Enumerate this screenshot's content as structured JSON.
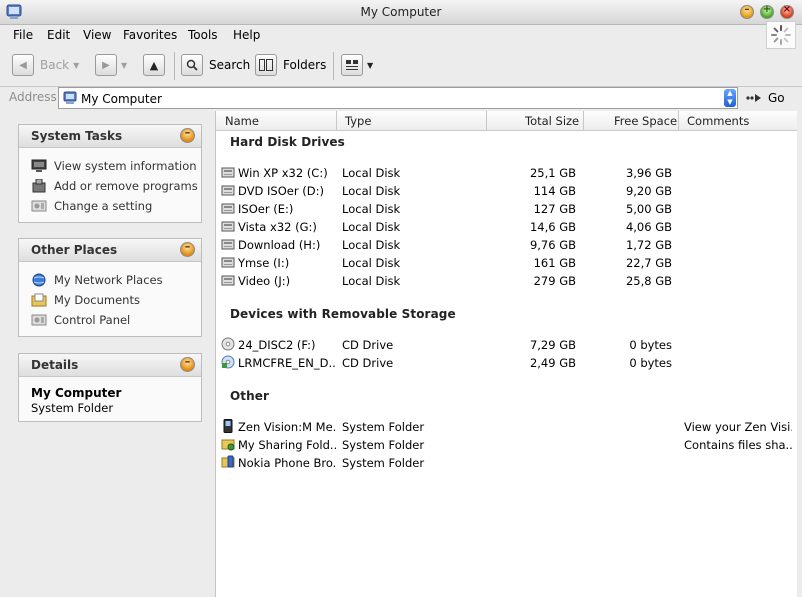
{
  "window": {
    "title": "My Computer"
  },
  "menu": [
    "File",
    "Edit",
    "View",
    "Favorites",
    "Tools",
    "Help"
  ],
  "toolbar": {
    "back": "Back",
    "search": "Search",
    "folders": "Folders"
  },
  "address": {
    "label": "Address",
    "value": "My Computer",
    "go": "Go"
  },
  "panels": {
    "system_tasks": {
      "title": "System Tasks",
      "items": [
        "View system information",
        "Add or remove programs",
        "Change a setting"
      ]
    },
    "other_places": {
      "title": "Other Places",
      "items": [
        "My Network Places",
        "My Documents",
        "Control Panel"
      ]
    },
    "details": {
      "title": "Details",
      "name": "My Computer",
      "sub": "System Folder"
    }
  },
  "columns": {
    "name": "Name",
    "type": "Type",
    "total": "Total Size",
    "free": "Free Space",
    "comments": "Comments"
  },
  "groups": {
    "hdd": {
      "title": "Hard Disk Drives",
      "rows": [
        {
          "name": "Win XP x32 (C:)",
          "type": "Local Disk",
          "total": "25,1 GB",
          "free": "3,96 GB",
          "comment": ""
        },
        {
          "name": "DVD ISOer (D:)",
          "type": "Local Disk",
          "total": "114 GB",
          "free": "9,20 GB",
          "comment": ""
        },
        {
          "name": "ISOer (E:)",
          "type": "Local Disk",
          "total": "127 GB",
          "free": "5,00 GB",
          "comment": ""
        },
        {
          "name": "Vista x32 (G:)",
          "type": "Local Disk",
          "total": "14,6 GB",
          "free": "4,06 GB",
          "comment": ""
        },
        {
          "name": "Download (H:)",
          "type": "Local Disk",
          "total": "9,76 GB",
          "free": "1,72 GB",
          "comment": ""
        },
        {
          "name": "Ymse (I:)",
          "type": "Local Disk",
          "total": "161 GB",
          "free": "22,7 GB",
          "comment": ""
        },
        {
          "name": "Video (J:)",
          "type": "Local Disk",
          "total": "279 GB",
          "free": "25,8 GB",
          "comment": ""
        }
      ]
    },
    "removable": {
      "title": "Devices with Removable Storage",
      "rows": [
        {
          "name": "24_DISC2 (F:)",
          "type": "CD Drive",
          "total": "7,29 GB",
          "free": "0 bytes",
          "comment": ""
        },
        {
          "name": "LRMCFRE_EN_D...",
          "type": "CD Drive",
          "total": "2,49 GB",
          "free": "0 bytes",
          "comment": ""
        }
      ]
    },
    "other": {
      "title": "Other",
      "rows": [
        {
          "name": "Zen Vision:M Me...",
          "type": "System Folder",
          "total": "",
          "free": "",
          "comment": "View your Zen Visi..."
        },
        {
          "name": "My Sharing Fold...",
          "type": "System Folder",
          "total": "",
          "free": "",
          "comment": "Contains files sha..."
        },
        {
          "name": "Nokia Phone Bro...",
          "type": "System Folder",
          "total": "",
          "free": "",
          "comment": ""
        }
      ]
    }
  }
}
